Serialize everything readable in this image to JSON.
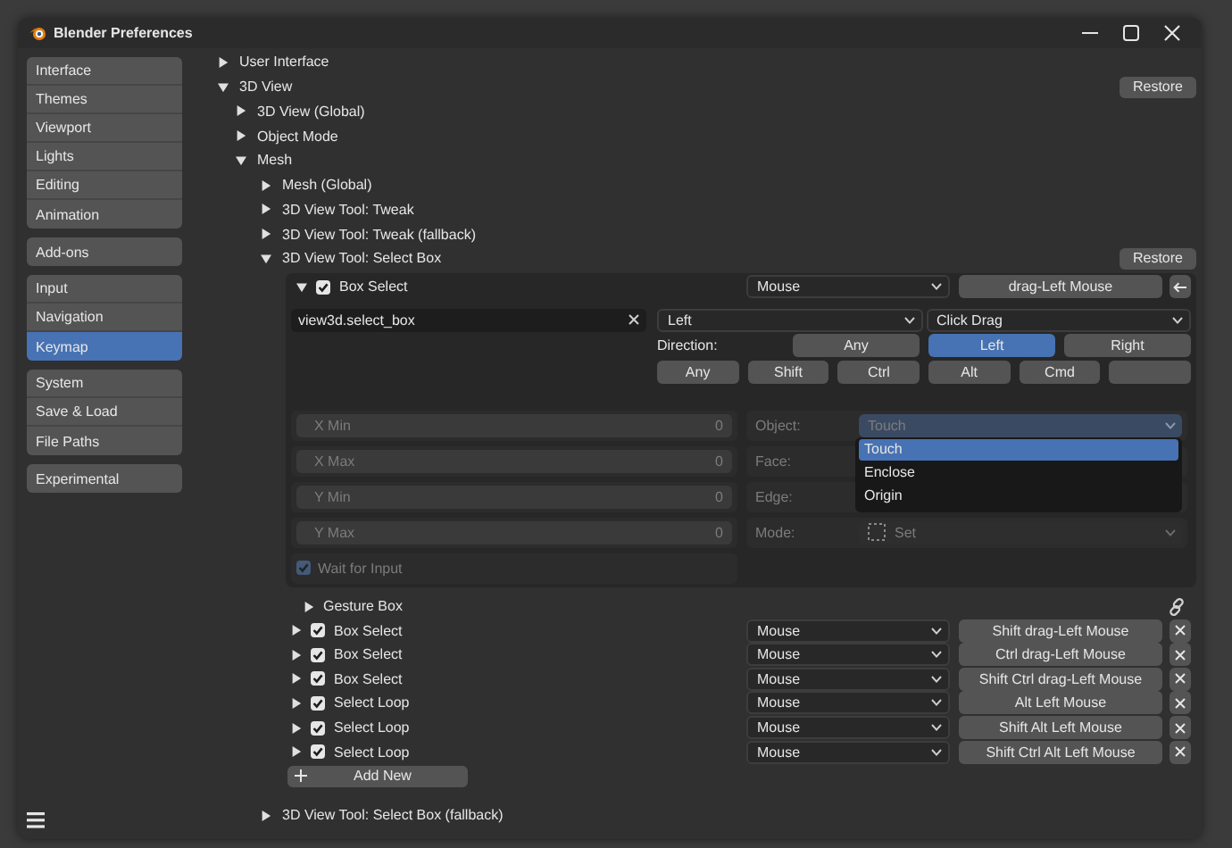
{
  "window": {
    "title": "Blender Preferences"
  },
  "sidebar": {
    "groups": [
      [
        {
          "label": "Interface",
          "selected": false
        },
        {
          "label": "Themes",
          "selected": false
        },
        {
          "label": "Viewport",
          "selected": false
        },
        {
          "label": "Lights",
          "selected": false
        },
        {
          "label": "Editing",
          "selected": false
        },
        {
          "label": "Animation",
          "selected": false
        }
      ],
      [
        {
          "label": "Add-ons",
          "selected": false
        }
      ],
      [
        {
          "label": "Input",
          "selected": false
        },
        {
          "label": "Navigation",
          "selected": false
        },
        {
          "label": "Keymap",
          "selected": true
        }
      ],
      [
        {
          "label": "System",
          "selected": false
        },
        {
          "label": "Save & Load",
          "selected": false
        },
        {
          "label": "File Paths",
          "selected": false
        }
      ],
      [
        {
          "label": "Experimental",
          "selected": false
        }
      ]
    ]
  },
  "tree": [
    {
      "label": "User Interface",
      "expanded": false
    },
    {
      "label": "3D View",
      "expanded": true,
      "action": "Restore",
      "children": [
        {
          "label": "3D View (Global)",
          "expanded": false
        },
        {
          "label": "Object Mode",
          "expanded": false
        },
        {
          "label": "Mesh",
          "expanded": true,
          "children": [
            {
              "label": "Mesh (Global)",
              "expanded": false
            },
            {
              "label": "3D View Tool: Tweak",
              "expanded": false
            },
            {
              "label": "3D View Tool: Tweak (fallback)",
              "expanded": false
            },
            {
              "label": "3D View Tool: Select Box",
              "expanded": true,
              "action": "Restore",
              "keymap": {
                "items": [
                  {
                    "name": "Box Select",
                    "checked": true,
                    "expanded": true,
                    "map_type": "Mouse",
                    "event": "drag-Left Mouse",
                    "details": {
                      "operator": "view3d.select_box",
                      "event_type": "Left",
                      "value": "Click Drag",
                      "direction_label": "Direction:",
                      "directions": [
                        {
                          "label": "Any",
                          "selected": false
                        },
                        {
                          "label": "Left",
                          "selected": true
                        },
                        {
                          "label": "Right",
                          "selected": false
                        }
                      ],
                      "modifiers": [
                        {
                          "label": "Any",
                          "on": false
                        },
                        {
                          "label": "Shift",
                          "on": false
                        },
                        {
                          "label": "Ctrl",
                          "on": false
                        },
                        {
                          "label": "Alt",
                          "on": false
                        },
                        {
                          "label": "Cmd",
                          "on": false
                        },
                        {
                          "on": false
                        }
                      ],
                      "properties": {
                        "disabled": true,
                        "left": [
                          {
                            "label": "X Min",
                            "value": "0"
                          },
                          {
                            "label": "X Max",
                            "value": "0"
                          },
                          {
                            "label": "Y Min",
                            "value": "0"
                          },
                          {
                            "label": "Y Max",
                            "value": "0"
                          }
                        ],
                        "wait_for_input": {
                          "label": "Wait for Input",
                          "checked": true
                        },
                        "right": [
                          {
                            "label": "Object:",
                            "kind": "dropdown",
                            "value": "Touch",
                            "open": true
                          },
                          {
                            "label": "Face:",
                            "kind": "hidden"
                          },
                          {
                            "label": "Edge:",
                            "kind": "hidden"
                          },
                          {
                            "label": "Mode:",
                            "kind": "mode",
                            "value": "Set"
                          }
                        ],
                        "menu": [
                          {
                            "label": "Touch",
                            "selected": true
                          },
                          {
                            "label": "Enclose",
                            "selected": false
                          },
                          {
                            "label": "Origin",
                            "selected": false
                          }
                        ]
                      },
                      "modal_keymap": {
                        "label": "Gesture Box",
                        "expanded": false
                      }
                    }
                  },
                  {
                    "name": "Box Select",
                    "checked": true,
                    "expanded": false,
                    "map_type": "Mouse",
                    "event": "Shift drag-Left Mouse"
                  },
                  {
                    "name": "Box Select",
                    "checked": true,
                    "expanded": false,
                    "map_type": "Mouse",
                    "event": "Ctrl drag-Left Mouse"
                  },
                  {
                    "name": "Box Select",
                    "checked": true,
                    "expanded": false,
                    "map_type": "Mouse",
                    "event": "Shift Ctrl drag-Left Mouse"
                  },
                  {
                    "name": "Select Loop",
                    "checked": true,
                    "expanded": false,
                    "map_type": "Mouse",
                    "event": "Alt Left Mouse"
                  },
                  {
                    "name": "Select Loop",
                    "checked": true,
                    "expanded": false,
                    "map_type": "Mouse",
                    "event": "Shift Alt Left Mouse"
                  },
                  {
                    "name": "Select Loop",
                    "checked": true,
                    "expanded": false,
                    "map_type": "Mouse",
                    "event": "Shift Ctrl Alt Left Mouse"
                  }
                ],
                "add_button": "Add New"
              }
            },
            {
              "label": "3D View Tool: Select Box (fallback)",
              "expanded": false
            }
          ]
        }
      ]
    }
  ]
}
